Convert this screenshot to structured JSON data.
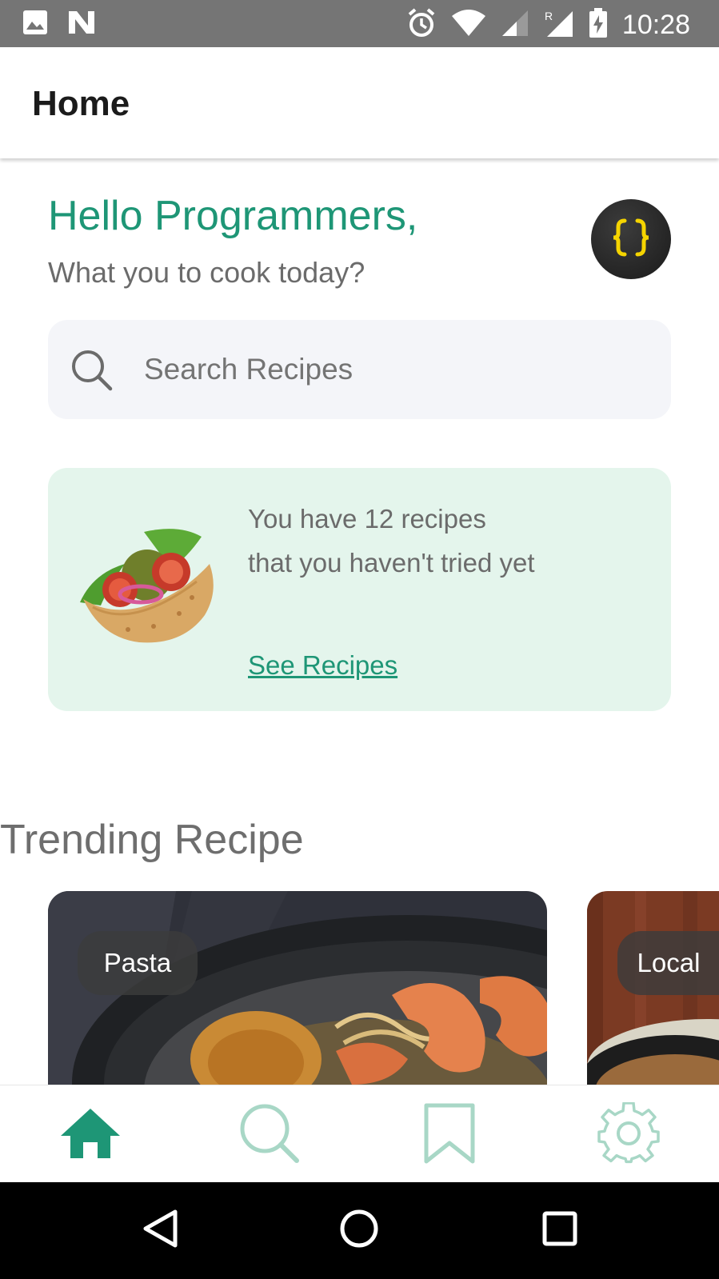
{
  "status_bar": {
    "time": "10:28",
    "icons": [
      "image-icon",
      "n-icon",
      "alarm-icon",
      "wifi-icon",
      "signal-icon",
      "roaming-signal-icon",
      "battery-charging-icon"
    ]
  },
  "app_bar": {
    "title": "Home"
  },
  "greeting": {
    "title": "Hello Programmers,",
    "subtitle": "What you to cook today?",
    "avatar_icon": "curly-braces-icon"
  },
  "search": {
    "placeholder": "Search Recipes",
    "value": ""
  },
  "promo": {
    "text": "You have 12 recipes that you haven't tried yet",
    "link_label": "See Recipes",
    "image_icon": "taco-icon"
  },
  "trending": {
    "title": "Trending Recipe",
    "cards": [
      {
        "tag": "Pasta"
      },
      {
        "tag": "Local"
      }
    ]
  },
  "bottom_nav": {
    "items": [
      {
        "icon": "home-icon",
        "active": true
      },
      {
        "icon": "search-icon",
        "active": false
      },
      {
        "icon": "bookmark-icon",
        "active": false
      },
      {
        "icon": "settings-gear-icon",
        "active": false
      }
    ]
  },
  "system_nav": {
    "icons": [
      "back-icon",
      "home-circle-icon",
      "recents-icon"
    ]
  },
  "colors": {
    "accent": "#1e9676",
    "accent_light": "#a8d7c6",
    "promo_bg": "#e4f5ec",
    "search_bg": "#f4f5f9",
    "status_bar": "#757575"
  }
}
